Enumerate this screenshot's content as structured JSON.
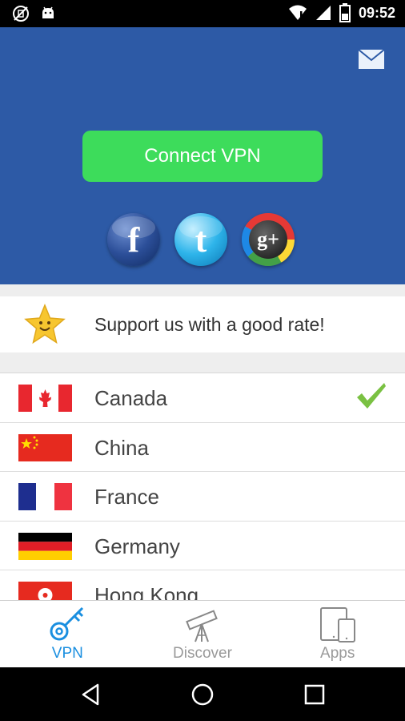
{
  "status_bar": {
    "time": "09:52",
    "icons": [
      "no-sim-icon",
      "android-icon",
      "wifi-icon",
      "signal-icon",
      "battery-icon"
    ]
  },
  "header": {
    "connect_label": "Connect VPN",
    "mail_icon": "mail-icon",
    "socials": [
      {
        "name": "facebook",
        "glyph": "f"
      },
      {
        "name": "twitter",
        "glyph": "t"
      },
      {
        "name": "google-plus",
        "glyph": "g+"
      }
    ],
    "background_color": "#2d5aa6",
    "button_color": "#3ddc5b"
  },
  "rate": {
    "text": "Support us with a good rate!",
    "icon": "star-icon"
  },
  "countries": [
    {
      "name": "Canada",
      "selected": true
    },
    {
      "name": "China",
      "selected": false
    },
    {
      "name": "France",
      "selected": false
    },
    {
      "name": "Germany",
      "selected": false
    },
    {
      "name": "Hong Kong",
      "selected": false
    }
  ],
  "tabs": [
    {
      "label": "VPN",
      "icon": "key-icon",
      "active": true
    },
    {
      "label": "Discover",
      "icon": "telescope-icon",
      "active": false
    },
    {
      "label": "Apps",
      "icon": "devices-icon",
      "active": false
    }
  ],
  "nav": [
    "back-icon",
    "home-icon",
    "recents-icon"
  ],
  "accent_color": "#1a8fe0"
}
